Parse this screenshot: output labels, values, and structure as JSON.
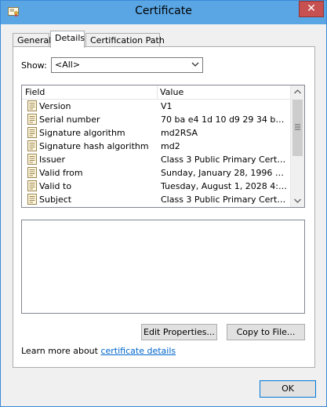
{
  "window": {
    "title": "Certificate",
    "close_glyph": "✕"
  },
  "tabs": [
    {
      "label": "General"
    },
    {
      "label": "Details"
    },
    {
      "label": "Certification Path"
    }
  ],
  "show": {
    "label": "Show:",
    "selected": "<All>"
  },
  "list": {
    "header_field": "Field",
    "header_value": "Value",
    "rows": [
      {
        "field": "Version",
        "value": "V1"
      },
      {
        "field": "Serial number",
        "value": "70 ba e4 1d 10 d9 29 34 b6 38 ..."
      },
      {
        "field": "Signature algorithm",
        "value": "md2RSA"
      },
      {
        "field": "Signature hash algorithm",
        "value": "md2"
      },
      {
        "field": "Issuer",
        "value": "Class 3 Public Primary Certifica..."
      },
      {
        "field": "Valid from",
        "value": "Sunday, January 28, 1996 5:0..."
      },
      {
        "field": "Valid to",
        "value": "Tuesday, August 1, 2028 4:59..."
      },
      {
        "field": "Subject",
        "value": "Class 3 Public Primary Certifica..."
      }
    ]
  },
  "buttons": {
    "edit_properties": "Edit Properties...",
    "copy_to_file": "Copy to File...",
    "ok": "OK"
  },
  "learn": {
    "prefix": "Learn more about ",
    "link": "certificate details"
  },
  "icons": {
    "title": "certificate-icon",
    "row": "certificate-field-icon"
  }
}
